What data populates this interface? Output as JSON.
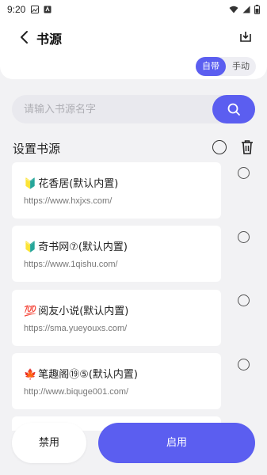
{
  "status_bar": {
    "time": "9:20"
  },
  "header": {
    "title": "书源",
    "mode_options": [
      "自带",
      "手动"
    ],
    "active_mode": "自带"
  },
  "search": {
    "placeholder": "请输入书源名字",
    "value": ""
  },
  "section": {
    "title": "设置书源"
  },
  "sources": [
    {
      "badge": "🔰",
      "name": "花香居(默认内置)",
      "url": "https://www.hxjxs.com/",
      "selected": false
    },
    {
      "badge": "🔰",
      "name": "奇书网⑦(默认内置)",
      "url": "https://www.1qishu.com/",
      "selected": false
    },
    {
      "badge": "💯",
      "name": "阅友小说(默认内置)",
      "url": "https://sma.yueyouxs.com/",
      "selected": false
    },
    {
      "badge": "🍁",
      "name": "笔趣阁⑲⑤(默认内置)",
      "url": "http://www.biquge001.com/",
      "selected": false
    }
  ],
  "actions": {
    "disable": "禁用",
    "enable": "启用"
  },
  "colors": {
    "accent": "#5b5ef0",
    "background": "#f2f2f4",
    "card": "#ffffff"
  }
}
